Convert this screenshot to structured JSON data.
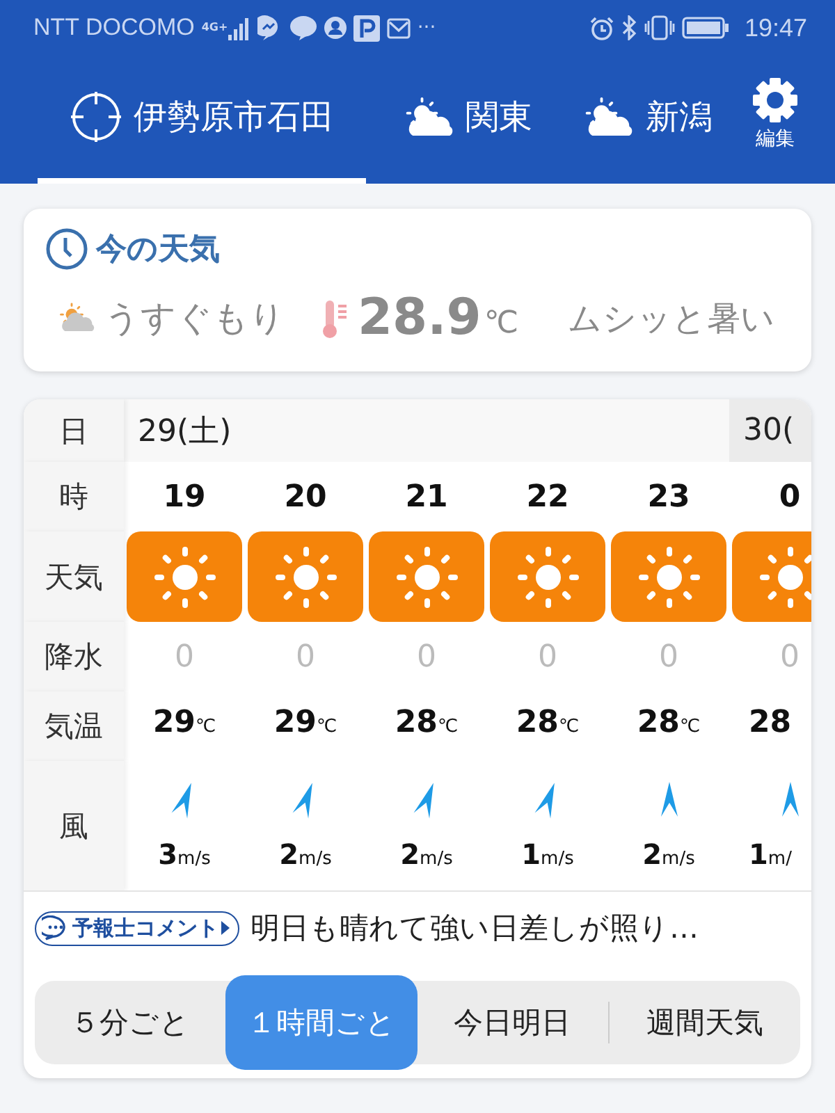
{
  "status_bar": {
    "carrier": "NTT DOCOMO",
    "network": "4G+",
    "more": "···",
    "time": "19:47"
  },
  "tabs": [
    {
      "label": "伊勢原市石田",
      "kind": "location",
      "selected": true
    },
    {
      "label": "関東",
      "kind": "weather",
      "selected": false
    },
    {
      "label": "新潟",
      "kind": "weather",
      "selected": false
    }
  ],
  "settings": {
    "label": "編集"
  },
  "current": {
    "title": "今の天気",
    "condition": "うすぐもり",
    "temp": "28.9",
    "unit": "℃",
    "feel": "ムシッと暑い"
  },
  "forecast": {
    "labels": {
      "date": "日",
      "hour": "時",
      "weather": "天気",
      "precip": "降水",
      "temp": "気温",
      "wind": "風"
    },
    "days": [
      {
        "label": "29(土)",
        "hours": [
          {
            "hour": "19",
            "kind": "sunny",
            "precip": "0",
            "temp": "29",
            "temp_unit": "℃",
            "wind": {
              "kind": "nne",
              "speed": "3",
              "unit": "m/s"
            }
          },
          {
            "hour": "20",
            "kind": "sunny",
            "precip": "0",
            "temp": "29",
            "temp_unit": "℃",
            "wind": {
              "kind": "nne",
              "speed": "2",
              "unit": "m/s"
            }
          },
          {
            "hour": "21",
            "kind": "sunny",
            "precip": "0",
            "temp": "28",
            "temp_unit": "℃",
            "wind": {
              "kind": "nne",
              "speed": "2",
              "unit": "m/s"
            }
          },
          {
            "hour": "22",
            "kind": "sunny",
            "precip": "0",
            "temp": "28",
            "temp_unit": "℃",
            "wind": {
              "kind": "nne",
              "speed": "1",
              "unit": "m/s"
            }
          },
          {
            "hour": "23",
            "kind": "sunny",
            "precip": "0",
            "temp": "28",
            "temp_unit": "℃",
            "wind": {
              "kind": "north",
              "speed": "2",
              "unit": "m/s"
            }
          }
        ]
      },
      {
        "label": "30(",
        "hours": [
          {
            "hour": "0",
            "kind": "sunny",
            "precip": "0",
            "temp": "28",
            "wind": {
              "kind": "north",
              "speed": "1",
              "unit": "m/"
            }
          }
        ]
      }
    ]
  },
  "comment": {
    "badge": "予報士コメント",
    "text": "明日も晴れて強い日差しが照り…"
  },
  "modes": [
    {
      "label": "５分ごと",
      "selected": false
    },
    {
      "label": "１時間ごと",
      "selected": true
    },
    {
      "label": "今日明日",
      "selected": false
    },
    {
      "label": "週間天気",
      "selected": false
    }
  ]
}
